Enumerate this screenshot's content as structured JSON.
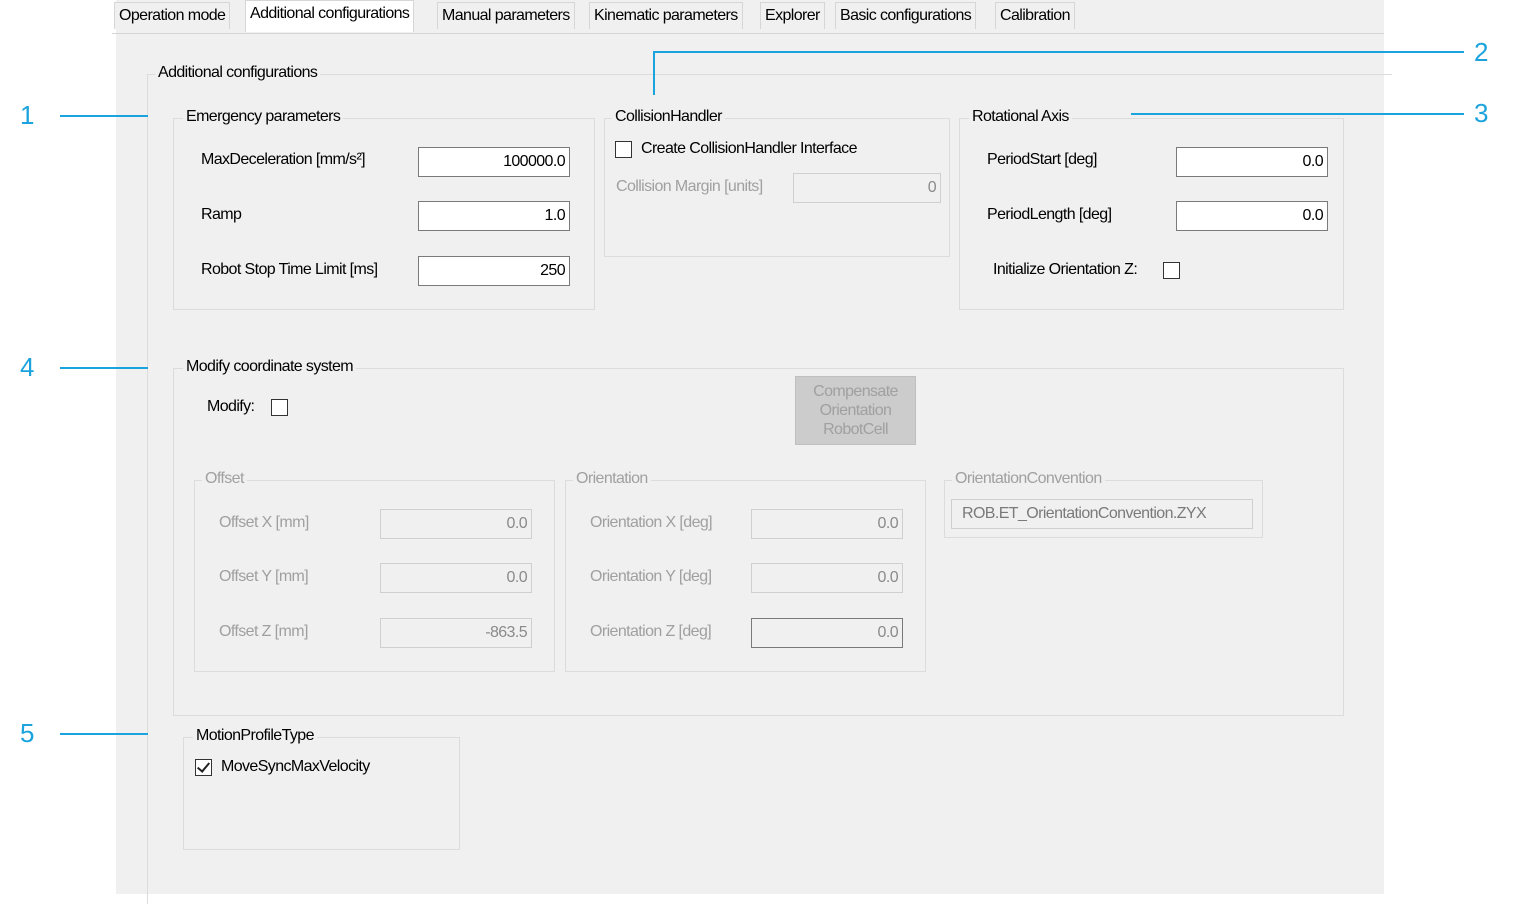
{
  "tabs": [
    {
      "label": "Operation mode"
    },
    {
      "label": "Additional configurations"
    },
    {
      "label": "Manual parameters"
    },
    {
      "label": "Kinematic parameters"
    },
    {
      "label": "Explorer"
    },
    {
      "label": "Basic configurations"
    },
    {
      "label": "Calibration"
    }
  ],
  "active_tab": "Additional configurations",
  "outer_group": {
    "title": "Additional configurations"
  },
  "emergency": {
    "title": "Emergency parameters",
    "max_decel_label": "MaxDeceleration [mm/s²]",
    "max_decel_value": "100000.0",
    "ramp_label": "Ramp",
    "ramp_value": "1.0",
    "stop_time_label": "Robot Stop Time Limit [ms]",
    "stop_time_value": "250"
  },
  "collision": {
    "title": "CollisionHandler",
    "create_label": "Create CollisionHandler Interface",
    "create_checked": false,
    "margin_label": "Collision Margin [units]",
    "margin_value": "0"
  },
  "rotational": {
    "title": "Rotational Axis",
    "period_start_label": "PeriodStart [deg]",
    "period_start_value": "0.0",
    "period_length_label": "PeriodLength [deg]",
    "period_length_value": "0.0",
    "init_orient_label": "Initialize Orientation Z:",
    "init_orient_checked": false
  },
  "modify": {
    "title": "Modify coordinate system",
    "modify_label": "Modify:",
    "modify_checked": false,
    "compensate_button": [
      "Compensate",
      "Orientation",
      "RobotCell"
    ],
    "offset": {
      "title": "Offset",
      "x_label": "Offset X [mm]",
      "x_value": "0.0",
      "y_label": "Offset Y [mm]",
      "y_value": "0.0",
      "z_label": "Offset Z [mm]",
      "z_value": "-863.5"
    },
    "orientation": {
      "title": "Orientation",
      "x_label": "Orientation X [deg]",
      "x_value": "0.0",
      "y_label": "Orientation Y [deg]",
      "y_value": "0.0",
      "z_label": "Orientation Z [deg]",
      "z_value": "0.0"
    },
    "convention": {
      "title": "OrientationConvention",
      "value": "ROB.ET_OrientationConvention.ZYX"
    }
  },
  "motion_profile": {
    "title": "MotionProfileType",
    "sync_label": "MoveSyncMaxVelocity",
    "sync_checked": true
  },
  "callouts": [
    "1",
    "2",
    "3",
    "4",
    "5"
  ],
  "colors": {
    "callout": "#1aa3dc",
    "panel": "#f0f0f0"
  }
}
